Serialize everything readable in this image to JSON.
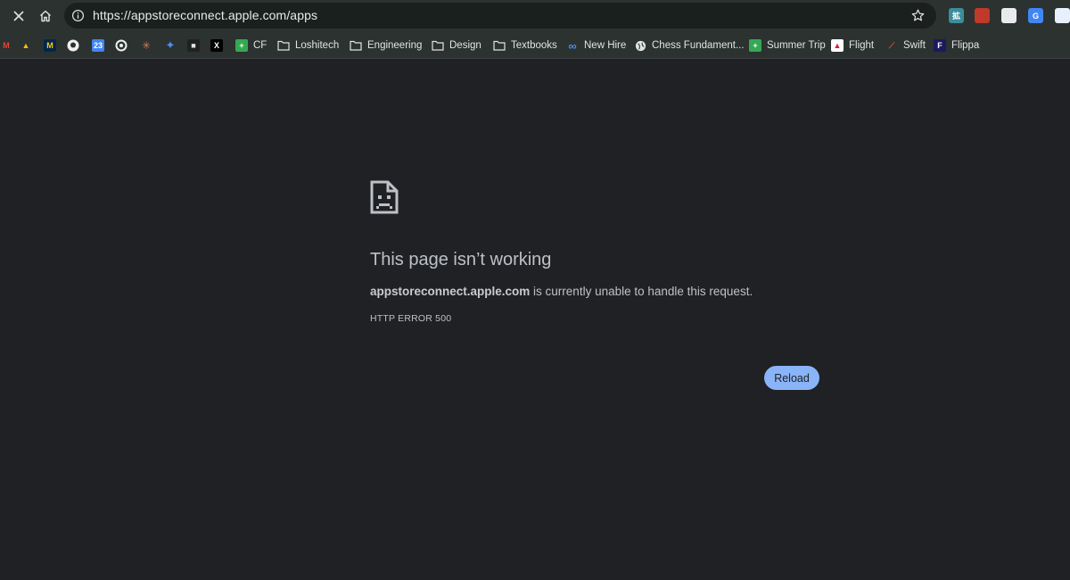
{
  "toolbar": {
    "close_icon": "close-icon",
    "home_icon": "home-icon",
    "url": "https://appstoreconnect.apple.com/apps",
    "info_icon": "info-icon",
    "star_icon": "star-icon",
    "extensions": [
      {
        "icon": "extension-1-icon",
        "color": "#3c8d9c",
        "glyph": "拡"
      },
      {
        "icon": "extension-2-icon",
        "color": "#c0392b",
        "glyph": ""
      },
      {
        "icon": "extension-3-icon",
        "color": "#e8eaed",
        "glyph": ""
      },
      {
        "icon": "google-translate-icon",
        "color": "#4285f4",
        "glyph": "G"
      },
      {
        "icon": "extension-5-icon",
        "color": "#e8f0fe",
        "glyph": ""
      }
    ]
  },
  "bookmarks": [
    {
      "icon": "gmail-icon",
      "label": "",
      "color": "#ea4335",
      "glyph": "M"
    },
    {
      "icon": "google-drive-icon",
      "label": "",
      "color": "#34a853",
      "glyph": "▲"
    },
    {
      "icon": "michigan-icon",
      "label": "",
      "color": "#00274c",
      "glyph": "M"
    },
    {
      "icon": "github-icon",
      "label": "",
      "color": "#f0f0f0",
      "glyph": ""
    },
    {
      "icon": "calendar-icon",
      "label": "",
      "color": "#4285f4",
      "glyph": "23"
    },
    {
      "icon": "openai-icon",
      "label": "",
      "color": "#f0f0f0",
      "glyph": ""
    },
    {
      "icon": "claude-icon",
      "label": "",
      "color": "#d97757",
      "glyph": "✳"
    },
    {
      "icon": "gemini-icon",
      "label": "",
      "color": "#4f8cf7",
      "glyph": "✦"
    },
    {
      "icon": "bookmark-cat-icon",
      "label": "",
      "color": "#202124",
      "glyph": "■"
    },
    {
      "icon": "x-icon",
      "label": "",
      "color": "#000000",
      "glyph": "X"
    },
    {
      "icon": "sheets-icon",
      "label": "CF",
      "color": "#34a853",
      "glyph": "+"
    },
    {
      "icon": "folder-icon",
      "label": "Loshitech",
      "color": "",
      "glyph": ""
    },
    {
      "icon": "folder-icon",
      "label": "Engineering",
      "color": "",
      "glyph": ""
    },
    {
      "icon": "folder-icon",
      "label": "Design",
      "color": "",
      "glyph": ""
    },
    {
      "icon": "folder-icon",
      "label": "Textbooks",
      "color": "",
      "glyph": ""
    },
    {
      "icon": "meta-icon",
      "label": "New Hire",
      "color": "",
      "glyph": "∞"
    },
    {
      "icon": "globe-icon",
      "label": "Chess Fundament...",
      "color": "",
      "glyph": ""
    },
    {
      "icon": "sheets-icon",
      "label": "Summer Trip",
      "color": "#34a853",
      "glyph": "+"
    },
    {
      "icon": "delta-icon",
      "label": "Flight",
      "color": "#e01933",
      "glyph": "▲"
    },
    {
      "icon": "swift-icon",
      "label": "Swift",
      "color": "",
      "glyph": "⟋"
    },
    {
      "icon": "flippa-icon",
      "label": "Flippa",
      "color": "#1a1a5e",
      "glyph": "F"
    }
  ],
  "error": {
    "icon": "sad-page-icon",
    "title": "This page isn’t working",
    "host": "appstoreconnect.apple.com",
    "message": " is currently unable to handle this request.",
    "code": "HTTP ERROR 500",
    "reload_label": "Reload"
  },
  "colors": {
    "background": "#202124",
    "toolbar": "#2b3230",
    "accent": "#8ab4f8"
  }
}
